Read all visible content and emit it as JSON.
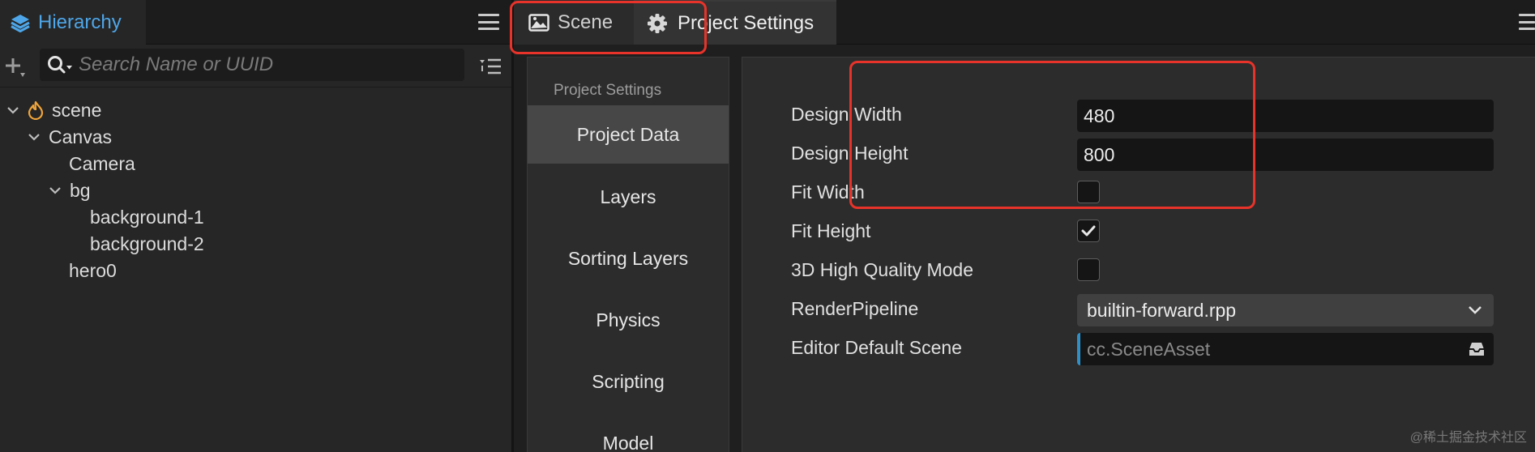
{
  "hierarchy": {
    "tab_label": "Hierarchy",
    "search_placeholder": "Search Name or UUID",
    "search_value": "",
    "tree": [
      {
        "label": "scene",
        "depth": 0,
        "expanded": true,
        "icon": "scene-flame-icon"
      },
      {
        "label": "Canvas",
        "depth": 1,
        "expanded": true
      },
      {
        "label": "Camera",
        "depth": 2
      },
      {
        "label": "bg",
        "depth": 2,
        "expanded": true
      },
      {
        "label": "background-1",
        "depth": 3
      },
      {
        "label": "background-2",
        "depth": 3
      },
      {
        "label": "hero0",
        "depth": 2
      }
    ]
  },
  "tabs": {
    "scene_label": "Scene",
    "project_settings_label": "Project Settings",
    "active": "Project Settings"
  },
  "settings_nav": {
    "heading": "Project Settings",
    "items": [
      "Project Data",
      "Layers",
      "Sorting Layers",
      "Physics",
      "Scripting",
      "Model"
    ],
    "active": "Project Data"
  },
  "project_data": {
    "design_width": {
      "label": "Design Width",
      "value": "480"
    },
    "design_height": {
      "label": "Design Height",
      "value": "800"
    },
    "fit_width": {
      "label": "Fit Width",
      "checked": false
    },
    "fit_height": {
      "label": "Fit Height",
      "checked": true
    },
    "high_quality_3d": {
      "label": "3D High Quality Mode",
      "checked": false
    },
    "render_pipeline": {
      "label": "RenderPipeline",
      "value": "builtin-forward.rpp"
    },
    "editor_default_scene": {
      "label": "Editor Default Scene",
      "value": "cc.SceneAsset"
    }
  },
  "watermark": "@稀土掘金技术社区",
  "colors": {
    "accent": "#4ea6e8",
    "highlight_box": "#e8332a",
    "asset_accent": "#2f8fc7",
    "scene_icon": "#f0a53a"
  }
}
